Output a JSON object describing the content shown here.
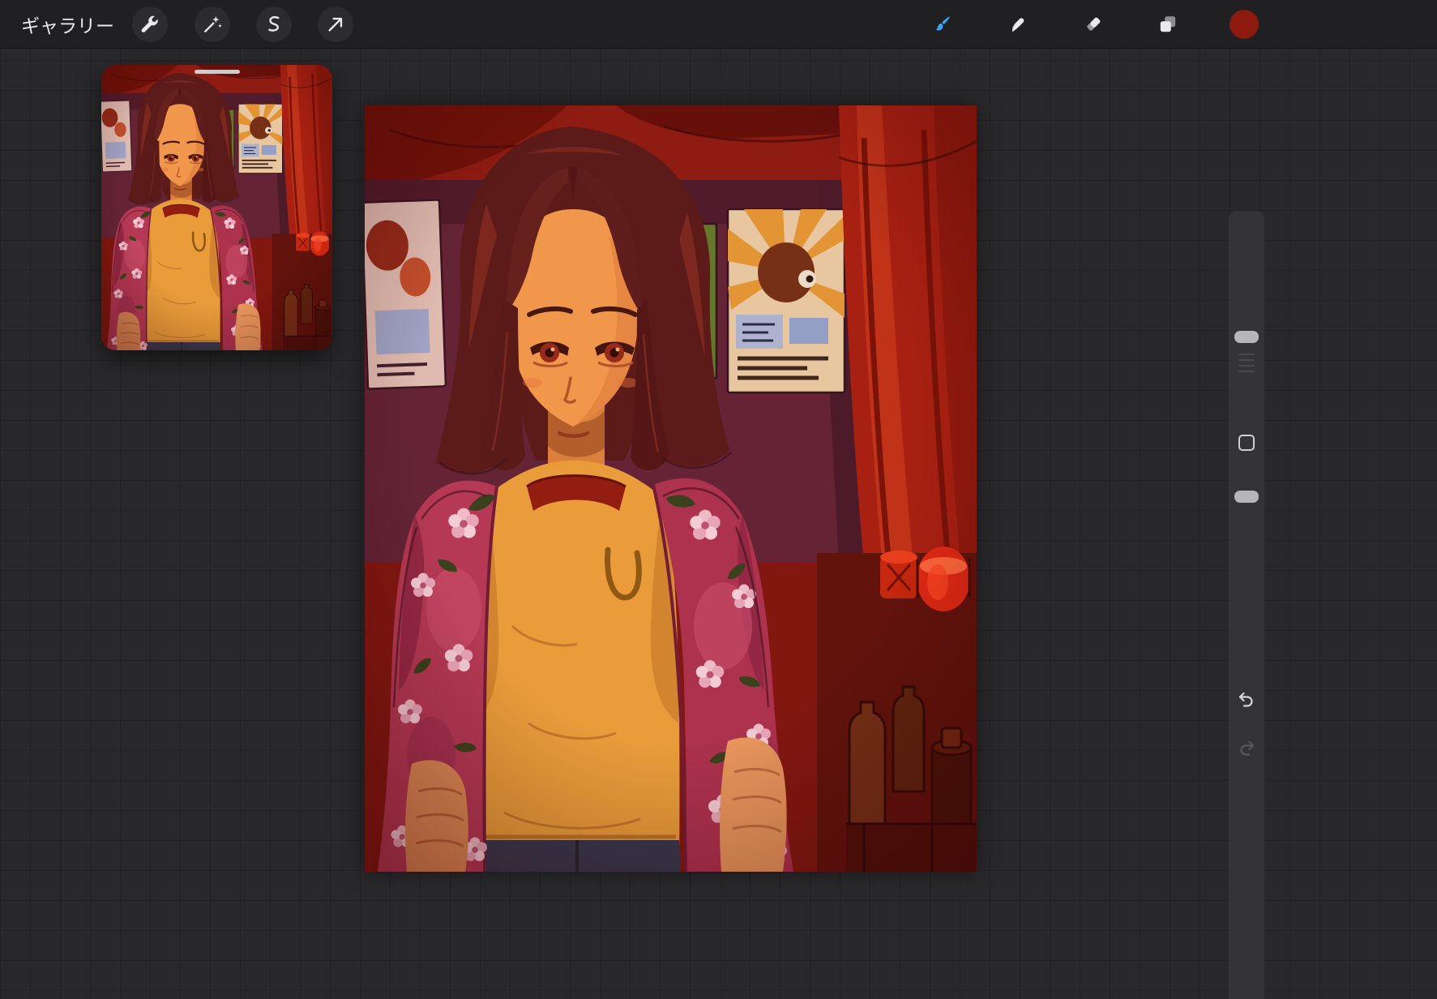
{
  "topbar": {
    "gallery_label": "ギャラリー",
    "left_tools": [
      {
        "id": "actions",
        "icon": "wrench-icon"
      },
      {
        "id": "adjustments",
        "icon": "magic-wand-icon"
      },
      {
        "id": "selection",
        "icon": "selection-s-icon"
      },
      {
        "id": "transform",
        "icon": "transform-arrow-icon"
      }
    ],
    "right_tools": [
      {
        "id": "paint",
        "icon": "paint-brush-icon",
        "active": true
      },
      {
        "id": "smudge",
        "icon": "smudge-icon",
        "active": false
      },
      {
        "id": "erase",
        "icon": "eraser-icon",
        "active": false
      },
      {
        "id": "layers",
        "icon": "layers-icon",
        "active": false
      },
      {
        "id": "color",
        "icon": "color-swatch",
        "active": false
      }
    ],
    "colors": {
      "active_tool_accent": "#3aa2f8",
      "color_swatch": "#8c1a0f",
      "bar_background": "#202022"
    }
  },
  "reference_window": {
    "kind": "floating canvas preview",
    "has_drag_handle": true
  },
  "canvas": {
    "subject": "portrait of a red-haired person in an orange ringer tee and pink floral shirt, red-lit room with posters, curtain and bottles",
    "palette": {
      "room_red": "#7c1710",
      "wall_purple": "#5c2438",
      "curtain_red": "#a32012",
      "skin": "#f09d50",
      "hair_maroon": "#541b1a",
      "tee_orange": "#e8a33c",
      "collar_red": "#8f1d12",
      "jacket_pink": "#b13a58"
    }
  },
  "sidebar": {
    "brush_size_handle_fraction_from_top": 0.55,
    "opacity_handle_fraction_from_top": 0.17,
    "undo_enabled": true,
    "redo_enabled": false
  },
  "workspace": {
    "background": "#29292b",
    "grid_visible": true
  }
}
